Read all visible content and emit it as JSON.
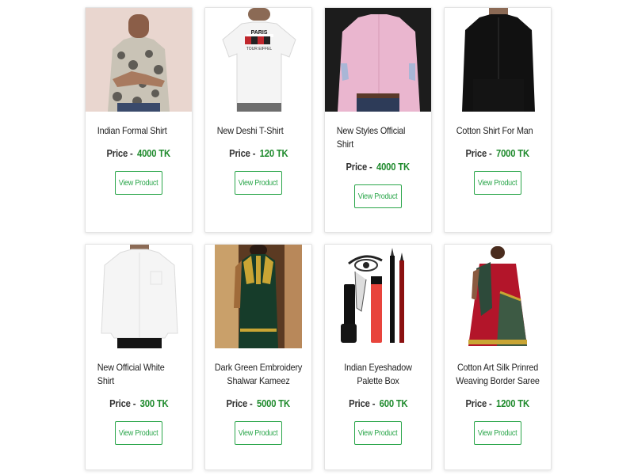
{
  "products": [
    {
      "name": "Indian Formal Shirt",
      "price_label": "Price -",
      "price": "4000 TK",
      "button": "View Product",
      "image": "patterned-shirt-photo"
    },
    {
      "name": "New Deshi T-Shirt",
      "price_label": "Price -",
      "price": "120 TK",
      "button": "View Product",
      "image": "white-tshirt-photo",
      "print_text": [
        "PARIS",
        "TOUR EIFFEL"
      ]
    },
    {
      "name": "New Styles Official Shirt",
      "price_label": "Price -",
      "price": "4000 TK",
      "button": "View Product",
      "image": "pink-shirt-photo"
    },
    {
      "name": "Cotton Shirt For Man",
      "price_label": "Price -",
      "price": "7000 TK",
      "button": "View Product",
      "image": "black-shirt-photo"
    },
    {
      "name": "New Official White Shirt",
      "price_label": "Price -",
      "price": "300 TK",
      "button": "View Product",
      "image": "white-shirt-photo"
    },
    {
      "name": "Dark Green Embroidery Shalwar Kameez",
      "price_label": "Price -",
      "price": "5000 TK",
      "button": "View Product",
      "image": "green-kameez-photo"
    },
    {
      "name": "Indian Eyeshadow Palette Box",
      "price_label": "Price -",
      "price": "600 TK",
      "button": "View Product",
      "image": "cosmetics-photo"
    },
    {
      "name": "Cotton Art Silk Prinred Weaving Border Saree",
      "price_label": "Price -",
      "price": "1200 TK",
      "button": "View Product",
      "image": "red-saree-photo"
    }
  ],
  "colors": {
    "price": "#1e8a2c",
    "button_border": "#2aa64a",
    "card_border": "#e3e3e3"
  }
}
